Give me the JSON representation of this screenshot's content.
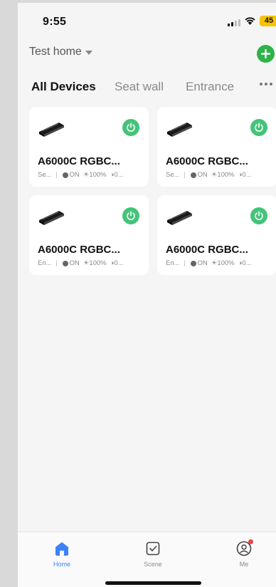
{
  "status_bar": {
    "time": "9:55",
    "battery": "45"
  },
  "header": {
    "home_name": "Test home"
  },
  "tabs": [
    {
      "label": "All Devices",
      "active": true
    },
    {
      "label": "Seat wall",
      "active": false
    },
    {
      "label": "Entrance",
      "active": false
    }
  ],
  "devices": [
    {
      "name": "A6000C RGBC...",
      "room": "Se...",
      "state": "ON",
      "brightness": "100%",
      "extra": "0..."
    },
    {
      "name": "A6000C RGBC...",
      "room": "Se...",
      "state": "ON",
      "brightness": "100%",
      "extra": "0..."
    },
    {
      "name": "A6000C RGBC...",
      "room": "En...",
      "state": "ON",
      "brightness": "100%",
      "extra": "0..."
    },
    {
      "name": "A6000C RGBC...",
      "room": "En...",
      "state": "ON",
      "brightness": "100%",
      "extra": "0..."
    }
  ],
  "tabbar": {
    "home": "Home",
    "scene": "Scene",
    "me": "Me"
  },
  "colors": {
    "power_on": "#43c479",
    "add": "#2db34a",
    "active_tab": "#3b82f6",
    "badge": "#ef4444"
  }
}
